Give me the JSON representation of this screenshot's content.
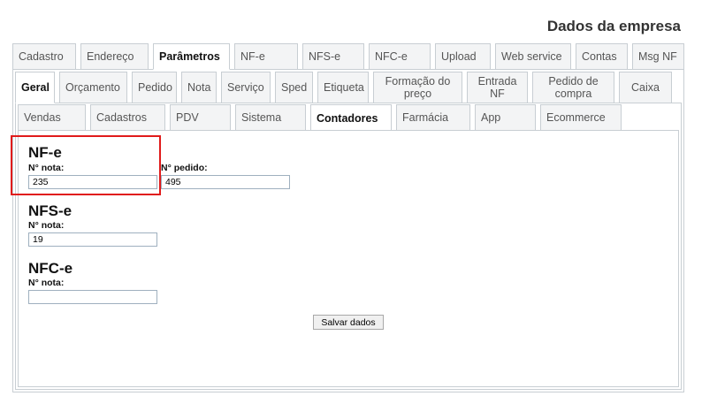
{
  "header": {
    "title": "Dados da empresa"
  },
  "tabs_main": [
    {
      "label": "Cadastro"
    },
    {
      "label": "Endereço"
    },
    {
      "label": "Parâmetros"
    },
    {
      "label": "NF-e"
    },
    {
      "label": "NFS-e"
    },
    {
      "label": "NFC-e"
    },
    {
      "label": "Upload"
    },
    {
      "label": "Web service"
    },
    {
      "label": "Contas"
    },
    {
      "label": "Msg NF"
    }
  ],
  "tabs_params": [
    {
      "label": "Geral"
    },
    {
      "label": "Orçamento"
    },
    {
      "label": "Pedido"
    },
    {
      "label": "Nota"
    },
    {
      "label": "Serviço"
    },
    {
      "label": "Sped"
    },
    {
      "label": "Etiqueta"
    },
    {
      "label": "Formação do preço"
    },
    {
      "label": "Entrada NF"
    },
    {
      "label": "Pedido de compra"
    },
    {
      "label": "Caixa"
    }
  ],
  "tabs_geral": [
    {
      "label": "Vendas"
    },
    {
      "label": "Cadastros"
    },
    {
      "label": "PDV"
    },
    {
      "label": "Sistema"
    },
    {
      "label": "Contadores"
    },
    {
      "label": "Farmácia"
    },
    {
      "label": "App"
    },
    {
      "label": "Ecommerce"
    }
  ],
  "nfe": {
    "title": "NF-e",
    "nota_label": "N° nota:",
    "nota_value": "235",
    "pedido_label": "N° pedido:",
    "pedido_value": "495"
  },
  "nfse": {
    "title": "NFS-e",
    "nota_label": "N° nota:",
    "nota_value": "19"
  },
  "nfce": {
    "title": "NFC-e",
    "nota_label": "N° nota:",
    "nota_value": ""
  },
  "actions": {
    "save_label": "Salvar dados"
  },
  "colors": {
    "highlight": "#e01b1b",
    "border": "#c8ced3",
    "inactive_tab": "#f3f4f5"
  }
}
